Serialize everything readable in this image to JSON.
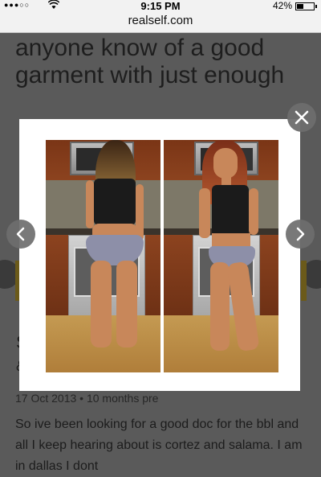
{
  "status_bar": {
    "signal": "●●●○○",
    "time": "9:15 PM",
    "battery_percent": "42%"
  },
  "browser": {
    "url": "realself.com"
  },
  "page": {
    "title": "anyone know of a good garment with just enough",
    "side_s": "S",
    "side_amp": "&",
    "date_line": "17 Oct 2013 • 10 months pre",
    "body": "So ive been looking for a good doc for the bbl and all I keep hearing about is cortez and salama. I am in dallas I dont"
  },
  "lightbox": {
    "close_icon": "close-icon",
    "prev_icon": "chevron-left-icon",
    "next_icon": "chevron-right-icon",
    "close_glyph": "✕",
    "prev_glyph": "‹",
    "next_glyph": "›"
  },
  "colors": {
    "overlay": "#4a4a4a",
    "lightbox_bg": "#ffffff",
    "nav_button": "#6e6e6e"
  }
}
